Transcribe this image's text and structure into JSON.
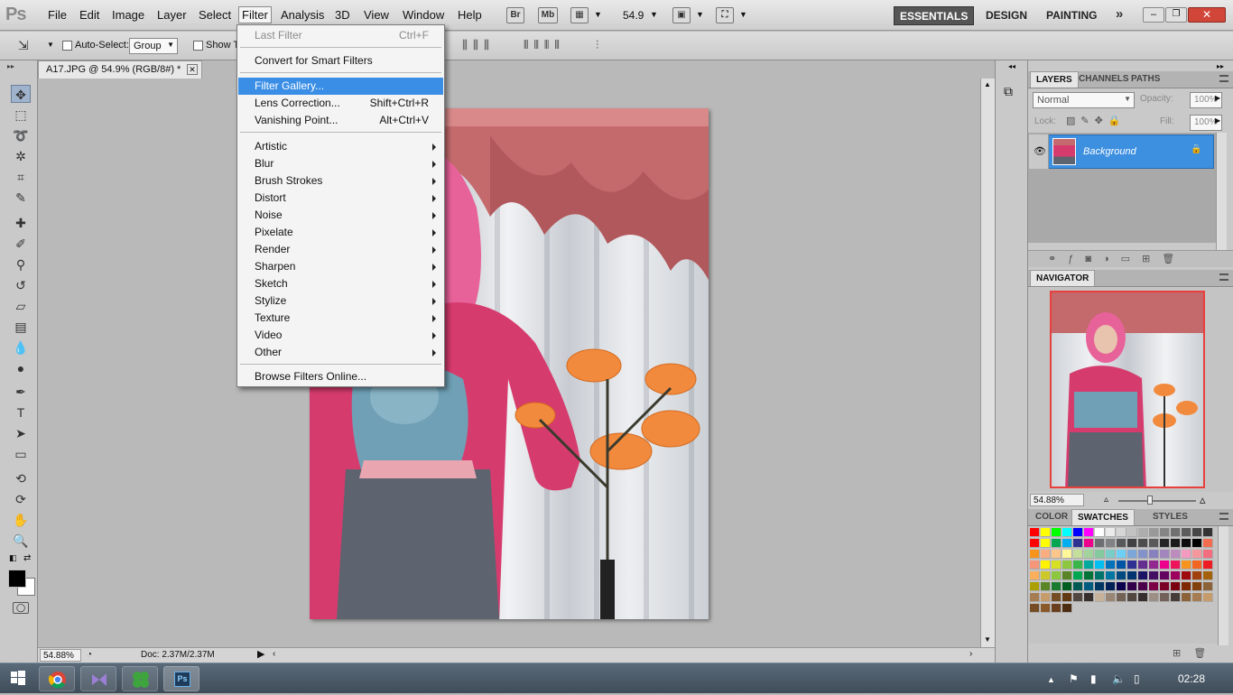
{
  "menubar": {
    "items": [
      "File",
      "Edit",
      "Image",
      "Layer",
      "Select",
      "Filter",
      "Analysis",
      "3D",
      "View",
      "Window",
      "Help"
    ],
    "bridge": "Br",
    "minibridge": "Mb",
    "zoom": "54.9",
    "workspaces": [
      "ESSENTIALS",
      "DESIGN",
      "PAINTING"
    ]
  },
  "options": {
    "auto_select": "Auto-Select:",
    "auto_select_value": "Group",
    "show_transform": "Show T"
  },
  "document": {
    "tab_title": "A17.JPG @ 54.9% (RGB/8#) *",
    "status_zoom": "54.88%",
    "status_doc": "Doc: 2.37M/2.37M"
  },
  "filter_menu": {
    "last_filter": {
      "label": "Last Filter",
      "shortcut": "Ctrl+F"
    },
    "convert": "Convert for Smart Filters",
    "gallery": "Filter Gallery...",
    "lens": {
      "label": "Lens Correction...",
      "shortcut": "Shift+Ctrl+R"
    },
    "vanishing": {
      "label": "Vanishing Point...",
      "shortcut": "Alt+Ctrl+V"
    },
    "submenus": [
      "Artistic",
      "Blur",
      "Brush Strokes",
      "Distort",
      "Noise",
      "Pixelate",
      "Render",
      "Sharpen",
      "Sketch",
      "Stylize",
      "Texture",
      "Video",
      "Other"
    ],
    "browse": "Browse Filters Online..."
  },
  "layers_panel": {
    "tabs": [
      "LAYERS",
      "CHANNELS",
      "PATHS"
    ],
    "blend_mode": "Normal",
    "opacity_label": "Opacity:",
    "opacity_value": "100%",
    "lock_label": "Lock:",
    "fill_label": "Fill:",
    "fill_value": "100%",
    "layer_name": "Background"
  },
  "navigator": {
    "title": "NAVIGATOR",
    "zoom": "54.88%"
  },
  "swatches_panel": {
    "tabs": [
      "COLOR",
      "SWATCHES",
      "STYLES"
    ],
    "colors": [
      "#ff0000",
      "#ffff00",
      "#00ff00",
      "#00ffff",
      "#0000ff",
      "#ff00ff",
      "#ffffff",
      "#ebebeb",
      "#d6d6d6",
      "#c2c2c2",
      "#adadad",
      "#999999",
      "#858585",
      "#707070",
      "#5c5c5c",
      "#474747",
      "#333333",
      "#ff0000",
      "#ffff00",
      "#00a651",
      "#00aeef",
      "#2e3192",
      "#ec008c",
      "#6d6e71",
      "#808285",
      "#58595b",
      "#414042",
      "#4d4d4d",
      "#595959",
      "#262626",
      "#1a1a1a",
      "#0d0d0d",
      "#000000",
      "#f26c4f",
      "#f7941d",
      "#f9ad81",
      "#fdc68a",
      "#fff799",
      "#c4df9b",
      "#a3d39c",
      "#82ca9d",
      "#7accc8",
      "#6dcff6",
      "#7da7d9",
      "#8393ca",
      "#8781bd",
      "#a186be",
      "#bd8cbf",
      "#f49ac1",
      "#f5989d",
      "#f26d7d",
      "#f69679",
      "#fff200",
      "#d7df23",
      "#8dc63f",
      "#39b54a",
      "#00a99d",
      "#00bff3",
      "#0072bc",
      "#0054a6",
      "#2e3192",
      "#662d91",
      "#92278f",
      "#ec008c",
      "#ed145b",
      "#f7941d",
      "#f26522",
      "#ed1c24",
      "#fbaf5d",
      "#ccc82a",
      "#8dc63f",
      "#598527",
      "#00a651",
      "#007236",
      "#00746b",
      "#0076a3",
      "#004a80",
      "#003471",
      "#1b1464",
      "#440e62",
      "#630460",
      "#9e005d",
      "#9e0b0f",
      "#a0410d",
      "#a36209",
      "#aba000",
      "#598527",
      "#197b30",
      "#005e20",
      "#005952",
      "#005b7f",
      "#003663",
      "#002157",
      "#0d004c",
      "#32004b",
      "#4b0049",
      "#7b0046",
      "#7a0026",
      "#79000e",
      "#7d2800",
      "#82400e",
      "#8c6239",
      "#a67c52",
      "#c69c6d",
      "#754c24",
      "#603913",
      "#534741",
      "#362f2d",
      "#c7b299",
      "#998675",
      "#736357",
      "#534741",
      "#362f2d",
      "#9e8f84",
      "#726159",
      "#463d39",
      "#8c6239",
      "#a67c52",
      "#c69c6d",
      "#754c24",
      "#8b5a2b",
      "#6b3f1d",
      "#4d2c12"
    ]
  },
  "taskbar": {
    "time": "02:28",
    "apps": [
      "chrome",
      "visual-studio",
      "clover",
      "photoshop"
    ]
  }
}
